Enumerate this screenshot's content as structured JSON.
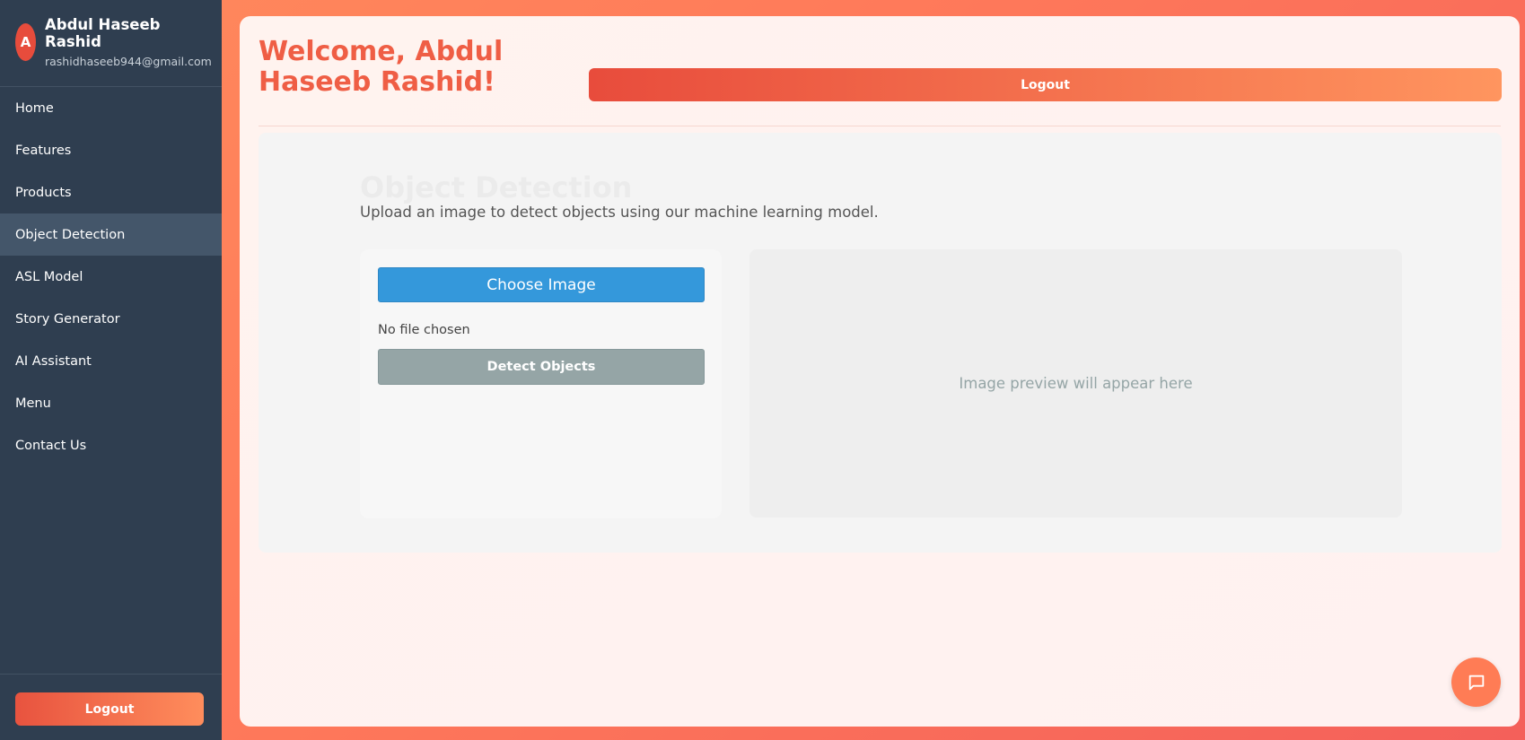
{
  "sidebar": {
    "avatar_initial": "A",
    "user_name": "Abdul Haseeb Rashid",
    "user_email": "rashidhaseeb944@gmail.com",
    "items": [
      {
        "label": "Home"
      },
      {
        "label": "Features"
      },
      {
        "label": "Products"
      },
      {
        "label": "Object Detection",
        "active": true
      },
      {
        "label": "ASL Model"
      },
      {
        "label": "Story Generator"
      },
      {
        "label": "AI Assistant"
      },
      {
        "label": "Menu"
      },
      {
        "label": "Contact Us"
      }
    ],
    "logout_label": "Logout"
  },
  "header": {
    "welcome_text": "Welcome, Abdul Haseeb Rashid!",
    "logout_label": "Logout"
  },
  "object_detection": {
    "title": "Object Detection",
    "subtitle": "Upload an image to detect objects using our machine learning model.",
    "choose_label": "Choose Image",
    "file_status": "No file chosen",
    "detect_label": "Detect Objects",
    "preview_placeholder": "Image preview will appear here"
  },
  "chat": {
    "icon": "chat-bubble-icon"
  },
  "colors": {
    "sidebar_bg": "#2f3e50",
    "accent": "#ef5e45",
    "primary_button": "#3498db",
    "disabled_button": "#95a5a6"
  }
}
